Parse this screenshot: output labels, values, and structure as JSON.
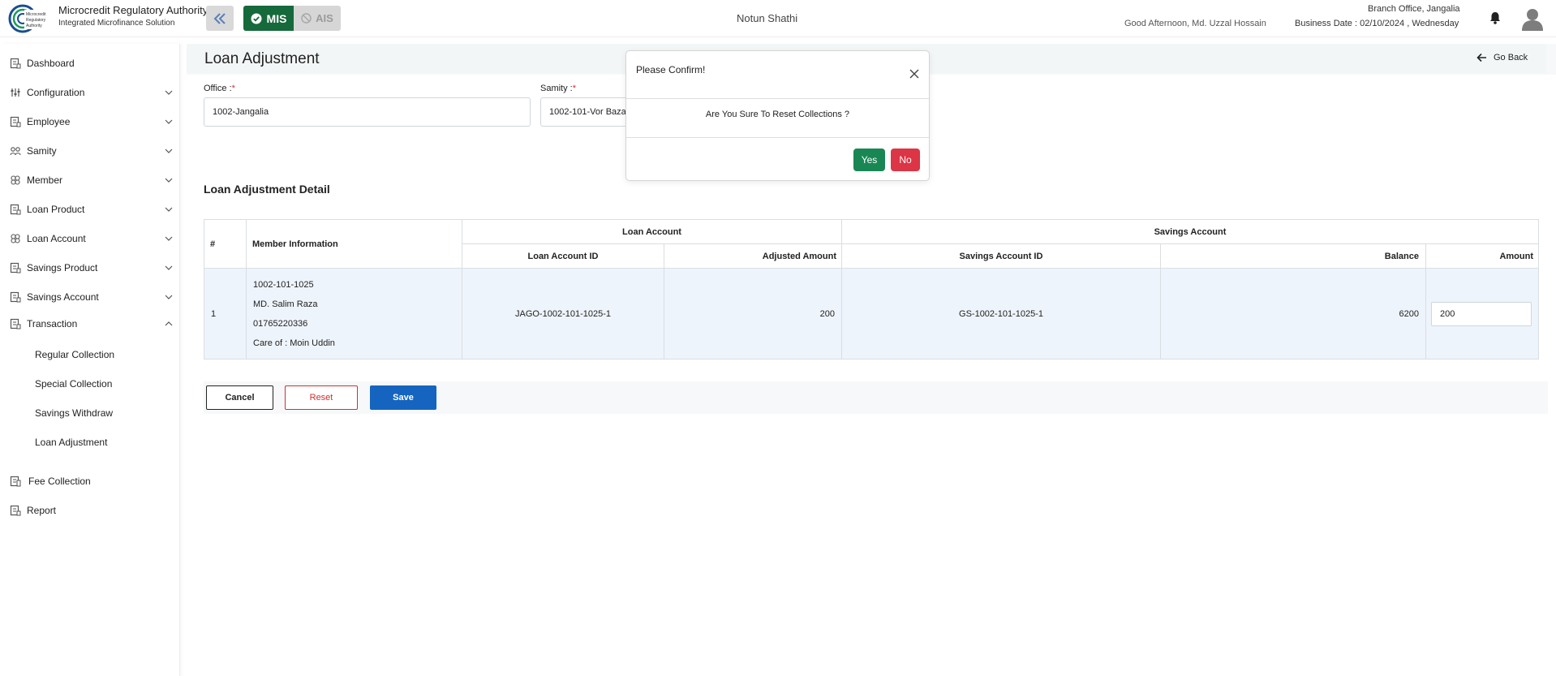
{
  "header": {
    "brand_title": "Microcredit Regulatory Authority",
    "brand_subtitle": "Integrated Microfinance Solution",
    "logo_text": "Microcredit Regulatory Authority",
    "mode_mis": "MIS",
    "mode_ais": "AIS",
    "org_name": "Notun Shathi",
    "greeting": "Good Afternoon, Md. Uzzal Hossain",
    "branch": "Branch Office, Jangalia",
    "business_date": "Business Date : 02/10/2024 , Wednesday"
  },
  "sidebar": {
    "items": [
      {
        "label": "Dashboard",
        "icon": "dashboard-icon"
      },
      {
        "label": "Configuration",
        "icon": "sliders-icon"
      },
      {
        "label": "Employee",
        "icon": "employee-icon"
      },
      {
        "label": "Samity",
        "icon": "group-icon"
      },
      {
        "label": "Member",
        "icon": "member-icon"
      },
      {
        "label": "Loan Product",
        "icon": "loan-product-icon"
      },
      {
        "label": "Loan Account",
        "icon": "loan-account-icon"
      },
      {
        "label": "Savings Product",
        "icon": "savings-product-icon"
      },
      {
        "label": "Savings Account",
        "icon": "savings-account-icon"
      },
      {
        "label": "Transaction",
        "icon": "transaction-icon"
      },
      {
        "label": "Fee Collection",
        "icon": "fee-icon"
      },
      {
        "label": "Report",
        "icon": "report-icon"
      }
    ],
    "transaction_subitems": [
      "Regular Collection",
      "Special Collection",
      "Savings Withdraw",
      "Loan Adjustment"
    ]
  },
  "page": {
    "title": "Loan Adjustment",
    "go_back": "Go Back",
    "office_label": "Office :",
    "office_value": "1002-Jangalia",
    "samity_label": "Samity :",
    "samity_value": "1002-101-Vor Bazar",
    "required_mark": "*",
    "section_title": "Loan Adjustment Detail"
  },
  "table": {
    "headers": {
      "num": "#",
      "member_info": "Member Information",
      "loan_account": "Loan Account",
      "savings_account": "Savings Account",
      "loan_account_id": "Loan Account ID",
      "adjusted_amount": "Adjusted Amount",
      "savings_account_id": "Savings Account ID",
      "balance": "Balance",
      "amount": "Amount"
    },
    "row": {
      "num": "1",
      "member_id": "1002-101-1025",
      "member_name": "MD. Salim Raza",
      "member_phone": "01765220336",
      "member_care_of": "Care of : Moin Uddin",
      "loan_account_id": "JAGO-1002-101-1025-1",
      "adjusted_amount": "200",
      "savings_account_id": "GS-1002-101-1025-1",
      "balance": "6200",
      "amount": "200"
    }
  },
  "buttons": {
    "cancel": "Cancel",
    "reset": "Reset",
    "save": "Save"
  },
  "dialog": {
    "title": "Please Confirm!",
    "message": "Are You Sure To Reset Collections ?",
    "yes": "Yes",
    "no": "No"
  },
  "colors": {
    "mis_green": "#15693b",
    "save_blue": "#1565c0",
    "reset_red": "#d32f2f",
    "yes_green": "#198754",
    "no_red": "#dc3545"
  }
}
